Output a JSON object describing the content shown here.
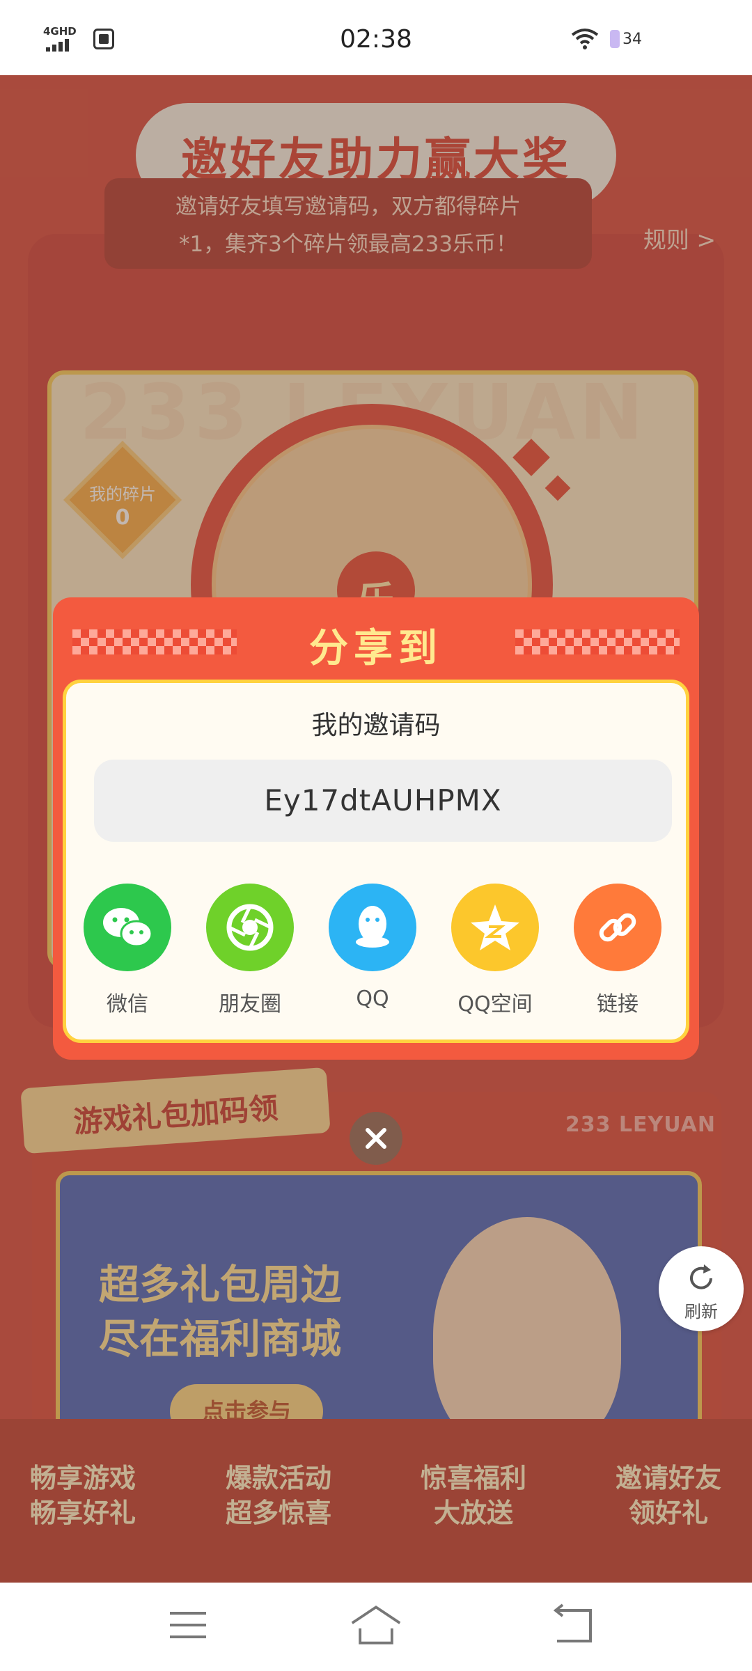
{
  "status_bar": {
    "network": "4GHD",
    "time": "02:38",
    "battery": "34"
  },
  "background": {
    "title": "邀好友助力赢大奖",
    "rule_text_line1": "邀请好友填写邀请码，双方都得碎片",
    "rule_text_line2": "*1，集齐3个碎片领最高233乐币！",
    "rule_link": "规则 >",
    "fragment_label": "我的碎片",
    "fragment_count": "0",
    "wheel_center": "乐",
    "watermark": "233 LEYUAN",
    "gift_section_title": "游戏礼包加码领",
    "leyuan_label": "233 LEYUAN",
    "banner_line1": "超多礼包周边",
    "banner_line2": "尽在福利商城",
    "banner_button": "点击参与",
    "features": [
      {
        "line1": "畅享游戏",
        "line2": "畅享好礼"
      },
      {
        "line1": "爆款活动",
        "line2": "超多惊喜"
      },
      {
        "line1": "惊喜福利",
        "line2": "大放送"
      },
      {
        "line1": "邀请好友",
        "line2": "领好礼"
      }
    ]
  },
  "dialog": {
    "title": "分享到",
    "code_label": "我的邀请码",
    "invite_code": "Ey17dtAUHPMX",
    "share_options": [
      {
        "label": "微信",
        "icon": "wechat-icon",
        "color": "#2dc84d"
      },
      {
        "label": "朋友圈",
        "icon": "moments-icon",
        "color": "#6fd12a"
      },
      {
        "label": "QQ",
        "icon": "qq-icon",
        "color": "#2cb4f4"
      },
      {
        "label": "QQ空间",
        "icon": "qzone-icon",
        "color": "#fcc72c"
      },
      {
        "label": "链接",
        "icon": "link-icon",
        "color": "#ff7a3a"
      }
    ]
  },
  "refresh_label": "刷新",
  "colors": {
    "accent": "#f35a3f",
    "title_yellow": "#ffe98f",
    "border_yellow": "#ffd23f"
  }
}
